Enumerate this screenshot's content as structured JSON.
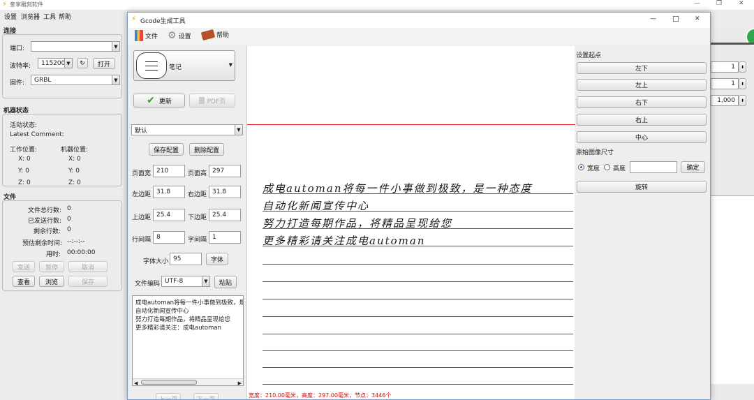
{
  "main_app": {
    "title": "奎享雕刻软件",
    "menu": [
      "设置",
      "浏览器",
      "工具",
      "帮助"
    ],
    "connection": {
      "section_title": "连接",
      "port_label": "端口:",
      "baud_label": "波特率:",
      "baud_value": "115200",
      "open_button": "打开",
      "firmware_label": "固件:",
      "firmware_value": "GRBL"
    },
    "machine_state": {
      "section_title": "机器状态",
      "active_state": "活动状态:",
      "latest_comment": "Latest Comment:",
      "work_pos": "工作位置:",
      "machine_pos": "机器位置:",
      "coords": [
        {
          "work": "X: 0",
          "machine": "X: 0"
        },
        {
          "work": "Y: 0",
          "machine": "Y: 0"
        },
        {
          "work": "Z: 0",
          "machine": "Z: 0"
        }
      ]
    },
    "file": {
      "section_title": "文件",
      "rows": [
        {
          "label": "文件总行数:",
          "value": "0"
        },
        {
          "label": "已发送行数:",
          "value": "0"
        },
        {
          "label": "剩余行数:",
          "value": "0"
        },
        {
          "label": "预估剩余时间:",
          "value": "--:--:--"
        },
        {
          "label": "用时:",
          "value": "00:00:00"
        }
      ],
      "buttons_row1": [
        "发送",
        "暂停",
        "取消"
      ],
      "buttons_row2": [
        "查看",
        "浏览",
        "保存"
      ]
    },
    "right_spinners": [
      "1",
      "1",
      "1,000"
    ]
  },
  "gcode_window": {
    "title": "Gcode生成工具",
    "toolbar": {
      "file": "文件",
      "settings": "设置",
      "help": "帮助"
    },
    "template_name": "笔记",
    "update_button": "更新",
    "pdf_button": "PDF页",
    "config_select": "默认",
    "save_config": "保存配置",
    "delete_config": "删除配置",
    "params": [
      {
        "l1": "页面宽",
        "v1": "210",
        "l2": "页面高",
        "v2": "297"
      },
      {
        "l1": "左边距",
        "v1": "31.8",
        "l2": "右边距",
        "v2": "31.8"
      },
      {
        "l1": "上边距",
        "v1": "25.4",
        "l2": "下边距",
        "v2": "25.4"
      },
      {
        "l1": "行间隔",
        "v1": "8",
        "l2": "字间隔",
        "v2": "1"
      }
    ],
    "font_size_label": "字体大小",
    "font_size_value": "95",
    "font_button": "字体",
    "encoding_label": "文件编码",
    "encoding_value": "UTF-8",
    "paste_button": "粘贴",
    "text_lines": [
      "成电automan将每一件小事做到极致，是",
      "自动化新闻宣传中心",
      "努力打造每期作品，将精品呈现给您",
      "更多精彩请关注：成电automan"
    ],
    "prev_page": "上一页",
    "next_page": "下一页",
    "handwriting": [
      "成电automan将每一件小事做到极致，是一种态度",
      "自动化新闻宣传中心",
      "努力打造每期作品，将精品呈现给您",
      "更多精彩请关注成电automan"
    ],
    "status": "宽度：210.00毫米，高度：297.00毫米，节点：3446个",
    "start_point": {
      "title": "设置起点",
      "buttons": [
        "左下",
        "左上",
        "右下",
        "右上",
        "中心"
      ]
    },
    "original_size": {
      "title": "原始图像尺寸",
      "width_radio": "宽度",
      "height_radio": "高度",
      "confirm": "确定",
      "rotate": "旋转"
    }
  },
  "colors": {
    "accent_red": "#e02020",
    "status_red": "#e00000"
  }
}
